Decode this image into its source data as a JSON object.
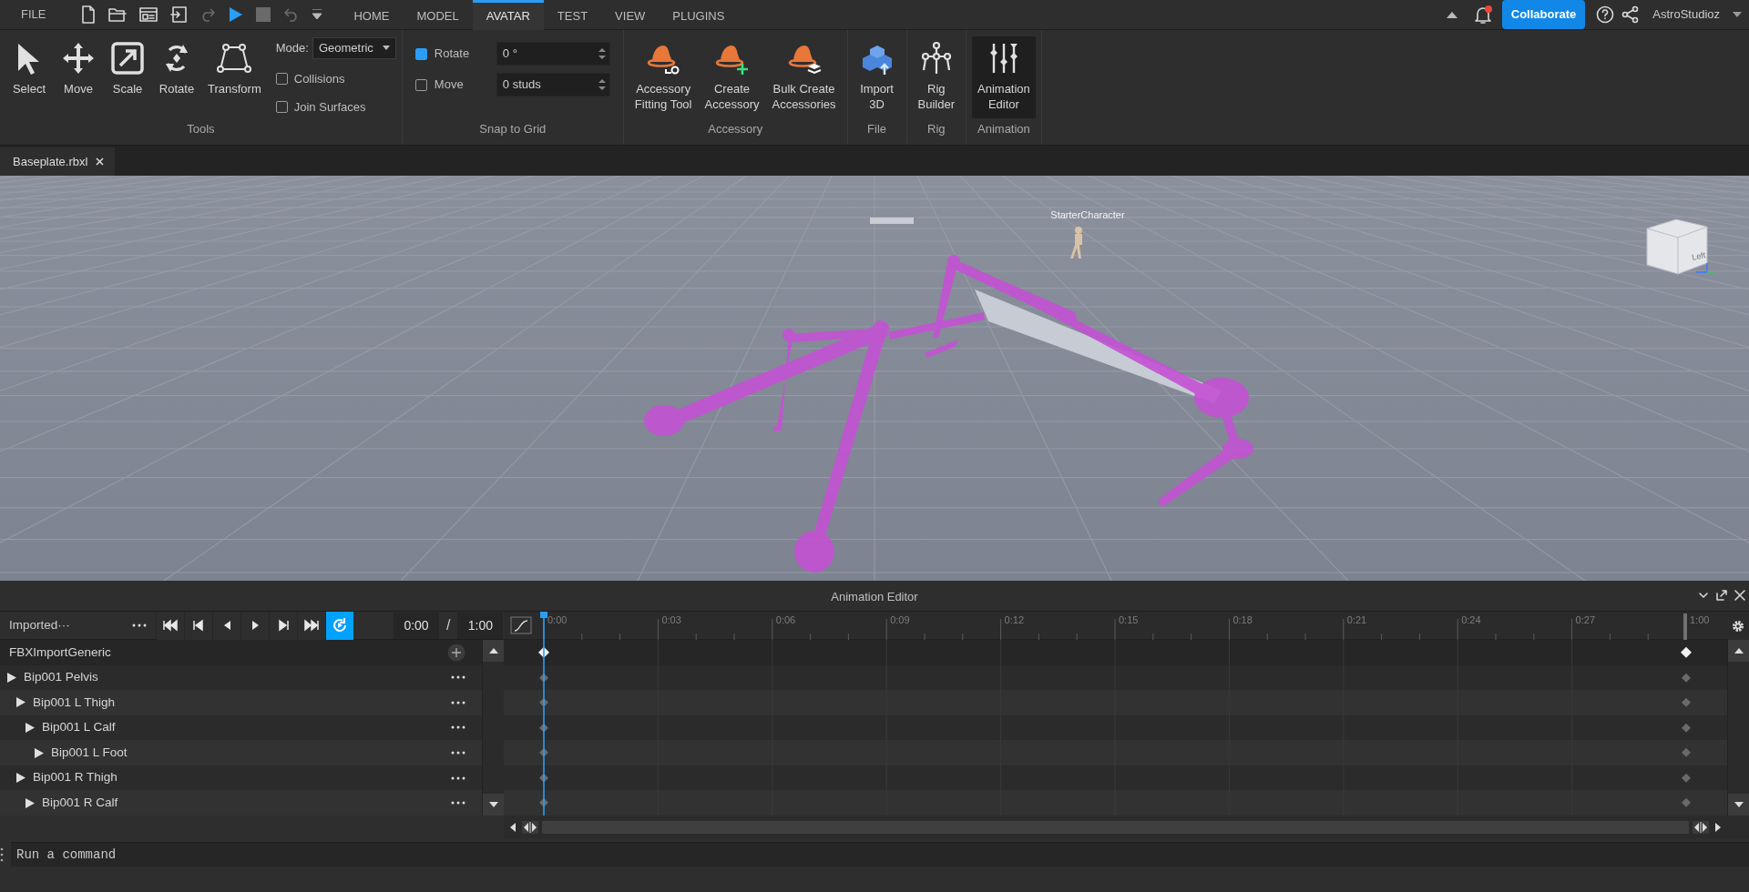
{
  "menu_bar": {
    "file_label": "FILE",
    "tabs": [
      {
        "label": "HOME",
        "selected": false
      },
      {
        "label": "MODEL",
        "selected": false
      },
      {
        "label": "AVATAR",
        "selected": true
      },
      {
        "label": "TEST",
        "selected": false
      },
      {
        "label": "VIEW",
        "selected": false
      },
      {
        "label": "PLUGINS",
        "selected": false
      }
    ],
    "notification_dot": true,
    "collaborate_label": "Collaborate",
    "user_name": "AstroStudioz"
  },
  "ribbon": {
    "groups": [
      {
        "kind": "tools",
        "label": "Tools",
        "buttons": [
          {
            "lines": [
              "Select"
            ],
            "active": false
          },
          {
            "lines": [
              "Move"
            ],
            "active": false
          },
          {
            "lines": [
              "Scale"
            ],
            "active": false
          },
          {
            "lines": [
              "Rotate"
            ],
            "active": false
          },
          {
            "lines": [
              "Transform"
            ],
            "active": false
          }
        ],
        "mode_label": "Mode:",
        "mode_value": "Geometric",
        "options": [
          {
            "label": "Collisions",
            "checked": false
          },
          {
            "label": "Join Surfaces",
            "checked": false
          }
        ]
      },
      {
        "kind": "snap",
        "label": "Snap to Grid",
        "rows": [
          {
            "label": "Rotate",
            "checked": true,
            "value": "0 °"
          },
          {
            "label": "Move",
            "checked": false,
            "value": "0 studs"
          }
        ]
      },
      {
        "kind": "buttons",
        "label": "Accessory",
        "buttons": [
          {
            "lines": [
              "Accessory",
              "Fitting Tool"
            ],
            "active": false
          },
          {
            "lines": [
              "Create",
              "Accessory"
            ],
            "active": false
          },
          {
            "lines": [
              "Bulk Create",
              "Accessories"
            ],
            "active": false
          }
        ]
      },
      {
        "kind": "buttons",
        "label": "File",
        "buttons": [
          {
            "lines": [
              "Import",
              "3D"
            ],
            "active": false
          }
        ]
      },
      {
        "kind": "buttons",
        "label": "Rig",
        "buttons": [
          {
            "lines": [
              "Rig",
              "Builder"
            ],
            "active": false
          }
        ]
      },
      {
        "kind": "buttons",
        "label": "Animation",
        "buttons": [
          {
            "lines": [
              "Animation",
              "Editor"
            ],
            "active": true
          }
        ]
      }
    ]
  },
  "document_tabs": [
    {
      "label": "Baseplate.rbxl",
      "selected": true
    }
  ],
  "viewport": {
    "character_label": "StarterCharacter",
    "view_cube_label": "Left"
  },
  "animation_editor": {
    "title": "Animation Editor",
    "animation_name": "Imported···",
    "loop": true,
    "current_time": "0:00",
    "time_separator": "/",
    "end_time": "1:00",
    "ruler_labels": [
      "0:00",
      "0:03",
      "0:06",
      "0:09",
      "0:12",
      "0:15",
      "0:18",
      "0:21",
      "0:24",
      "0:27",
      "1:00"
    ],
    "rig": {
      "name": "FBXImportGeneric",
      "children": [
        {
          "name": "Bip001 Pelvis",
          "children": [
            {
              "name": "Bip001 L Thigh",
              "children": [
                {
                  "name": "Bip001 L Calf",
                  "children": [
                    {
                      "name": "Bip001 L Foot"
                    }
                  ]
                }
              ]
            },
            {
              "name": "Bip001 R Thigh",
              "children": [
                {
                  "name": "Bip001 R Calf"
                }
              ]
            }
          ]
        }
      ]
    }
  },
  "command_bar": {
    "placeholder": "Run a command"
  }
}
